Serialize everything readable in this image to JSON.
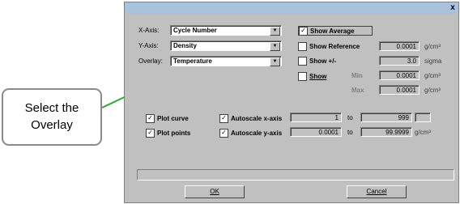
{
  "dialog": {
    "close_label": "x",
    "x_axis_label": "X-Axis:",
    "y_axis_label": "Y-Axis:",
    "overlay_label": "Overlay:",
    "x_axis_value": "Cycle Number",
    "y_axis_value": "Density",
    "overlay_value": "Temperature",
    "show_average": "Show Average",
    "show_reference": "Show Reference",
    "show_pm": "Show +/-",
    "show": "Show",
    "min_label": "Min",
    "max_label": "Max",
    "reference_value": "0.0001",
    "reference_unit": "g/cm³",
    "pm_value": "3.0",
    "pm_unit": "sigma",
    "min_value": "0.0001",
    "min_unit": "g/cm³",
    "max_value": "0.0001",
    "max_unit": "g/cm³",
    "plot_curve": "Plot curve",
    "plot_points": "Plot points",
    "autoscale_x": "Autoscale x-axis",
    "autoscale_y": "Autoscale y-axis",
    "x_from": "1",
    "x_to_label": "to",
    "x_to": "999",
    "y_from": "0.0001",
    "y_to_label": "to",
    "y_to": "99.9999",
    "y_unit": "g/cm³",
    "ok": "OK",
    "cancel": "Cancel",
    "check_mark": "✓",
    "arrow_glyph": "▼"
  },
  "callout": {
    "line1": "Select the",
    "line2": "Overlay"
  }
}
